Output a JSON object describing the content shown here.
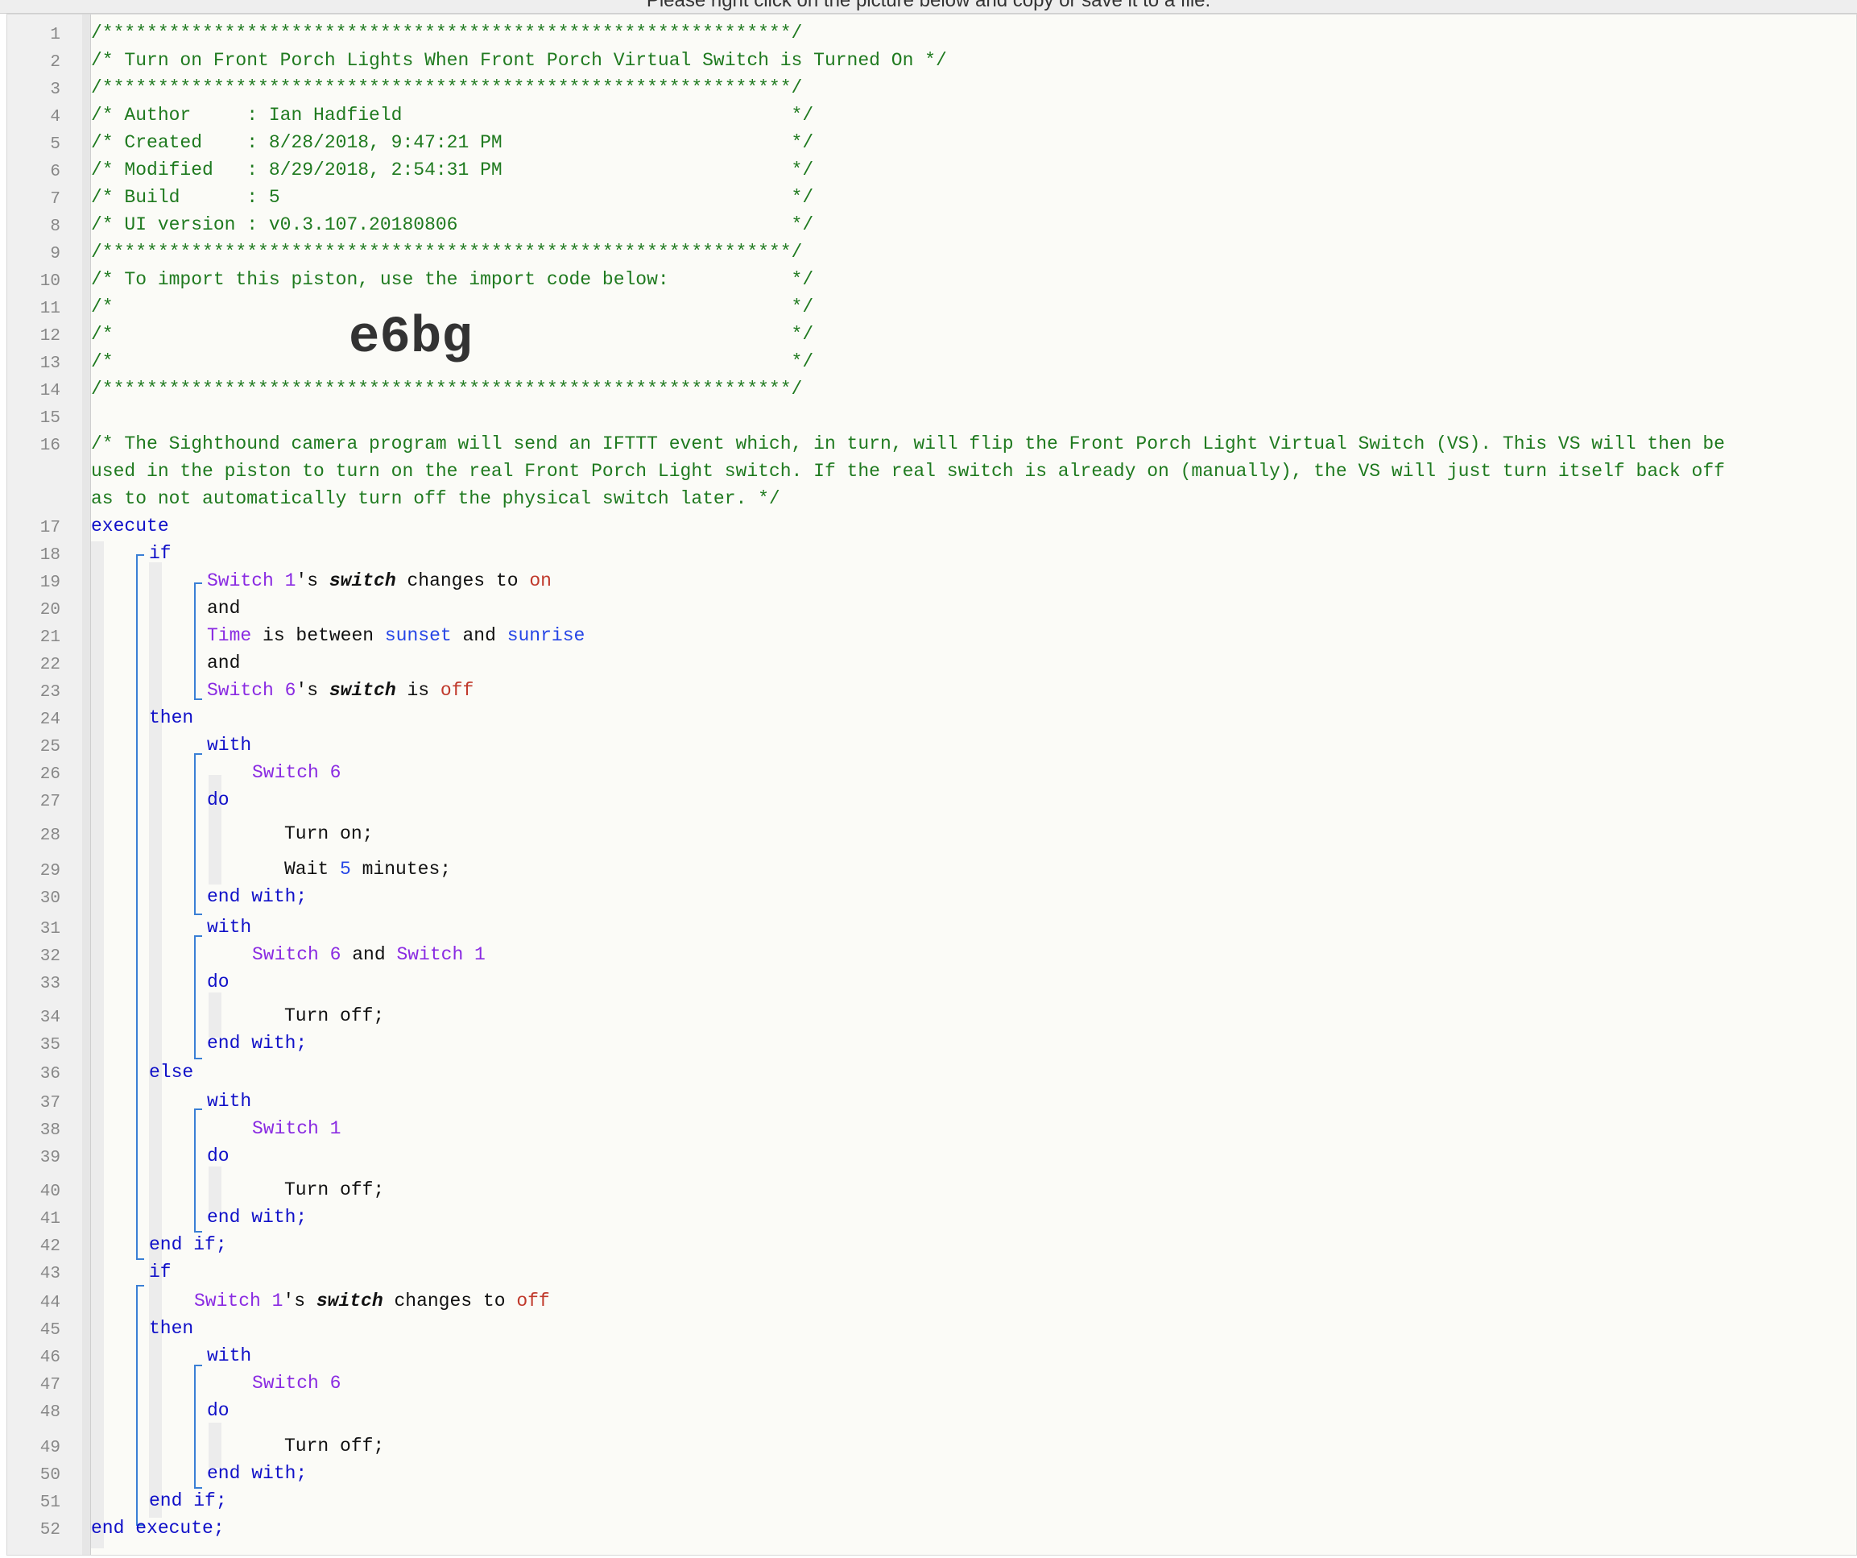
{
  "banner": "Please right click on the picture below and copy or save it to a file.",
  "import_code": "e6bg",
  "lines": [
    "/**************************************************************/",
    "/* Turn on Front Porch Lights When Front Porch Virtual Switch is Turned On */",
    "/**************************************************************/",
    "/* Author     : Ian Hadfield                                   */",
    "/* Created    : 8/28/2018, 9:47:21 PM                          */",
    "/* Modified   : 8/29/2018, 2:54:31 PM                          */",
    "/* Build      : 5                                              */",
    "/* UI version : v0.3.107.20180806                              */",
    "/**************************************************************/",
    "/* To import this piston, use the import code below:           */",
    "/*                                                             */",
    "/*                                                             */",
    "/*                                                             */",
    "/**************************************************************/",
    "",
    "/* The Sighthound camera program will send an IFTTT event which, in turn, will flip the Front Porch Light Virtual Switch (VS). This VS will then be",
    "used in the piston to turn on the real Front Porch Light switch. If the real switch is already on (manually), the VS will just turn itself back off",
    "as to not automatically turn off the physical switch later. */"
  ],
  "kw": {
    "execute": "execute",
    "if": "if",
    "then": "then",
    "else": "else",
    "with": "with",
    "do": "do",
    "end_with": "end with;",
    "end_if": "end if;",
    "end_execute": "end execute;",
    "and": "and"
  },
  "devices": {
    "switch1": "Switch 1",
    "switch6": "Switch 6",
    "time": "Time",
    "s6_and": "Switch 6",
    "and_word": " and ",
    "s1_and": "Switch 1"
  },
  "text": {
    "poss": "'s ",
    "switch_attr": "switch",
    "changes_to": " changes to ",
    "on_val": "on",
    "off_val": "off",
    "is_between": " is between ",
    "sunset": "sunset",
    "sunrise": "sunrise",
    "and_mid": " and ",
    "is": " is ",
    "turn_on": "Turn on;",
    "wait": "Wait ",
    "five": "5",
    "minutes": " minutes;",
    "turn_off": "Turn off;"
  }
}
